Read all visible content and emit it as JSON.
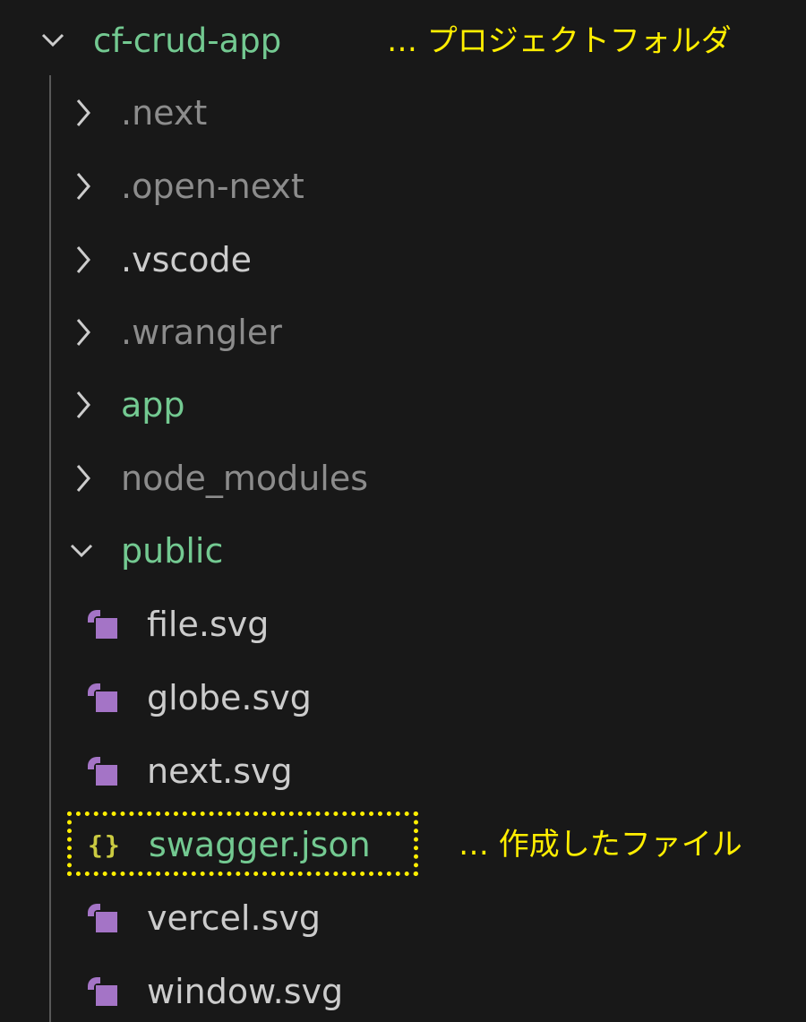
{
  "root": {
    "label": "cf-crud-app",
    "expanded": true,
    "annotation": "… プロジェクトフォルダ"
  },
  "folders": [
    {
      "label": ".next",
      "expanded": false
    },
    {
      "label": ".open-next",
      "expanded": false
    },
    {
      "label": ".vscode",
      "expanded": false
    },
    {
      "label": ".wrangler",
      "expanded": false
    },
    {
      "label": "app",
      "expanded": false
    },
    {
      "label": "node_modules",
      "expanded": false
    },
    {
      "label": "public",
      "expanded": true
    }
  ],
  "files": [
    {
      "label": "file.svg",
      "icon": "svg-file-icon"
    },
    {
      "label": "globe.svg",
      "icon": "svg-file-icon"
    },
    {
      "label": "next.svg",
      "icon": "svg-file-icon"
    },
    {
      "label": "swagger.json",
      "icon": "json-file-icon",
      "highlighted": true,
      "annotation": "… 作成したファイル"
    },
    {
      "label": "vercel.svg",
      "icon": "svg-file-icon"
    },
    {
      "label": "window.svg",
      "icon": "svg-file-icon"
    }
  ],
  "colors": {
    "background": "#181818",
    "folder_green": "#73c991",
    "dim_text": "#8c8c8c",
    "svg_icon_purple": "#a474c6",
    "json_icon_yellow": "#cbcb41",
    "annotation_yellow": "#ffee00"
  }
}
